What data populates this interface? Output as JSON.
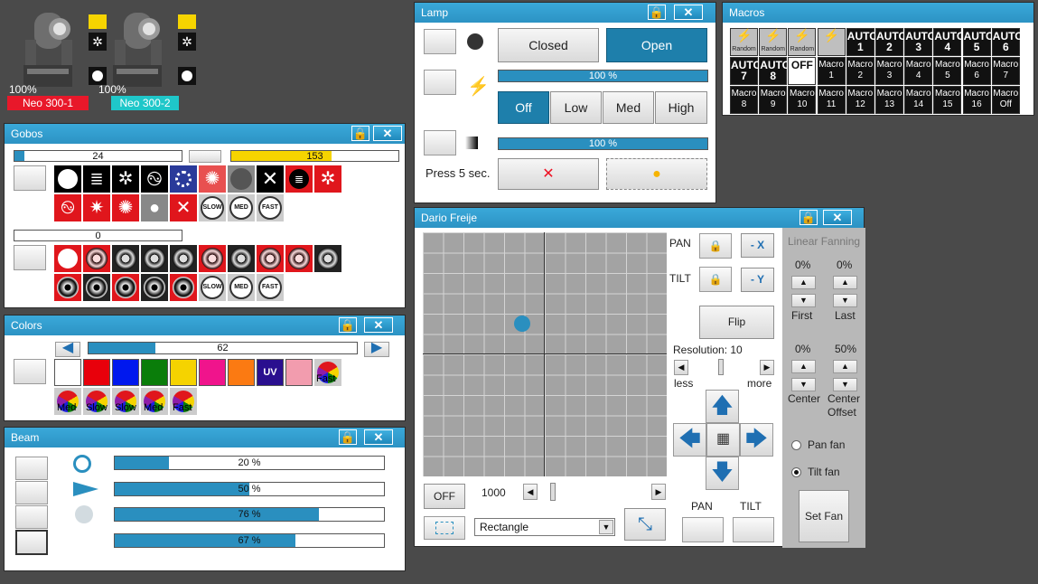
{
  "fixtures": [
    {
      "name": "Neo 300-1",
      "level": "100%",
      "color": "#e8182a"
    },
    {
      "name": "Neo 300-2",
      "level": "100%",
      "color": "#1fc7c9"
    }
  ],
  "gobos": {
    "title": "Gobos",
    "gobo1_value": "24",
    "gobo1_pct": 0.06,
    "rot_value": "153",
    "rot_pct": 0.6,
    "gobo2_value": "0",
    "wheel1_labels": [
      "SLOW",
      "MED",
      "FAST"
    ],
    "wheel2_labels": [
      "SLOW",
      "MED",
      "FAST"
    ]
  },
  "colors": {
    "title": "Colors",
    "value": "62",
    "pct": 0.25,
    "swatches": [
      "#ffffff",
      "#e8000b",
      "#0018ee",
      "#0a7d0a",
      "#f5d300",
      "#f0148c",
      "#fb7a12",
      "#2a0f8f",
      "#f29cae"
    ],
    "uv_label": "UV",
    "fast_label": "Fast",
    "bottom_labels": [
      "Med",
      "Slow",
      "Slow",
      "Med",
      "Fast"
    ],
    "accent": "#2a8fbf"
  },
  "beam": {
    "title": "Beam",
    "bars": [
      {
        "text": "20 %",
        "pct": 0.2
      },
      {
        "text": "50 %",
        "pct": 0.5
      },
      {
        "text": "76 %",
        "pct": 0.76
      },
      {
        "text": "67 %",
        "pct": 0.67
      }
    ]
  },
  "lamp": {
    "title": "Lamp",
    "closed": "Closed",
    "open": "Open",
    "bar1": "100 %",
    "off": "Off",
    "low": "Low",
    "med": "Med",
    "high": "High",
    "bar2": "100 %",
    "press": "Press 5 sec."
  },
  "macros": {
    "title": "Macros",
    "row1": [
      "Random",
      "Random",
      "Random",
      "",
      "AUTO 1",
      "AUTO 2",
      "AUTO 3",
      "AUTO 4",
      "AUTO 5",
      "AUTO 6"
    ],
    "row2": [
      "AUTO 7",
      "AUTO 8",
      "OFF",
      "Macro 1",
      "Macro 2",
      "Macro 3",
      "Macro 4",
      "Macro 5",
      "Macro 6",
      "Macro 7"
    ],
    "row3": [
      "Macro 8",
      "Macro 9",
      "Macro 10",
      "Macro 11",
      "Macro 12",
      "Macro 13",
      "Macro 14",
      "Macro 15",
      "Macro 16",
      "Macro Off"
    ]
  },
  "pantilt": {
    "title": "Dario Freije",
    "pan": "PAN",
    "tilt": "TILT",
    "negx": "- X",
    "negy": "- Y",
    "flip": "Flip",
    "resolution": "Resolution: 10",
    "less": "less",
    "more": "more",
    "off": "OFF",
    "speed": "1000",
    "shape": "Rectangle",
    "pan_lbl": "PAN",
    "tilt_lbl": "TILT",
    "fan_title": "Linear Fanning",
    "first_val": "0%",
    "last_val": "0%",
    "first": "First",
    "last": "Last",
    "center_val": "0%",
    "offset_val": "50%",
    "center": "Center",
    "center_offset": "Center Offset",
    "pan_fan": "Pan fan",
    "tilt_fan": "Tilt fan",
    "set_fan": "Set Fan"
  }
}
